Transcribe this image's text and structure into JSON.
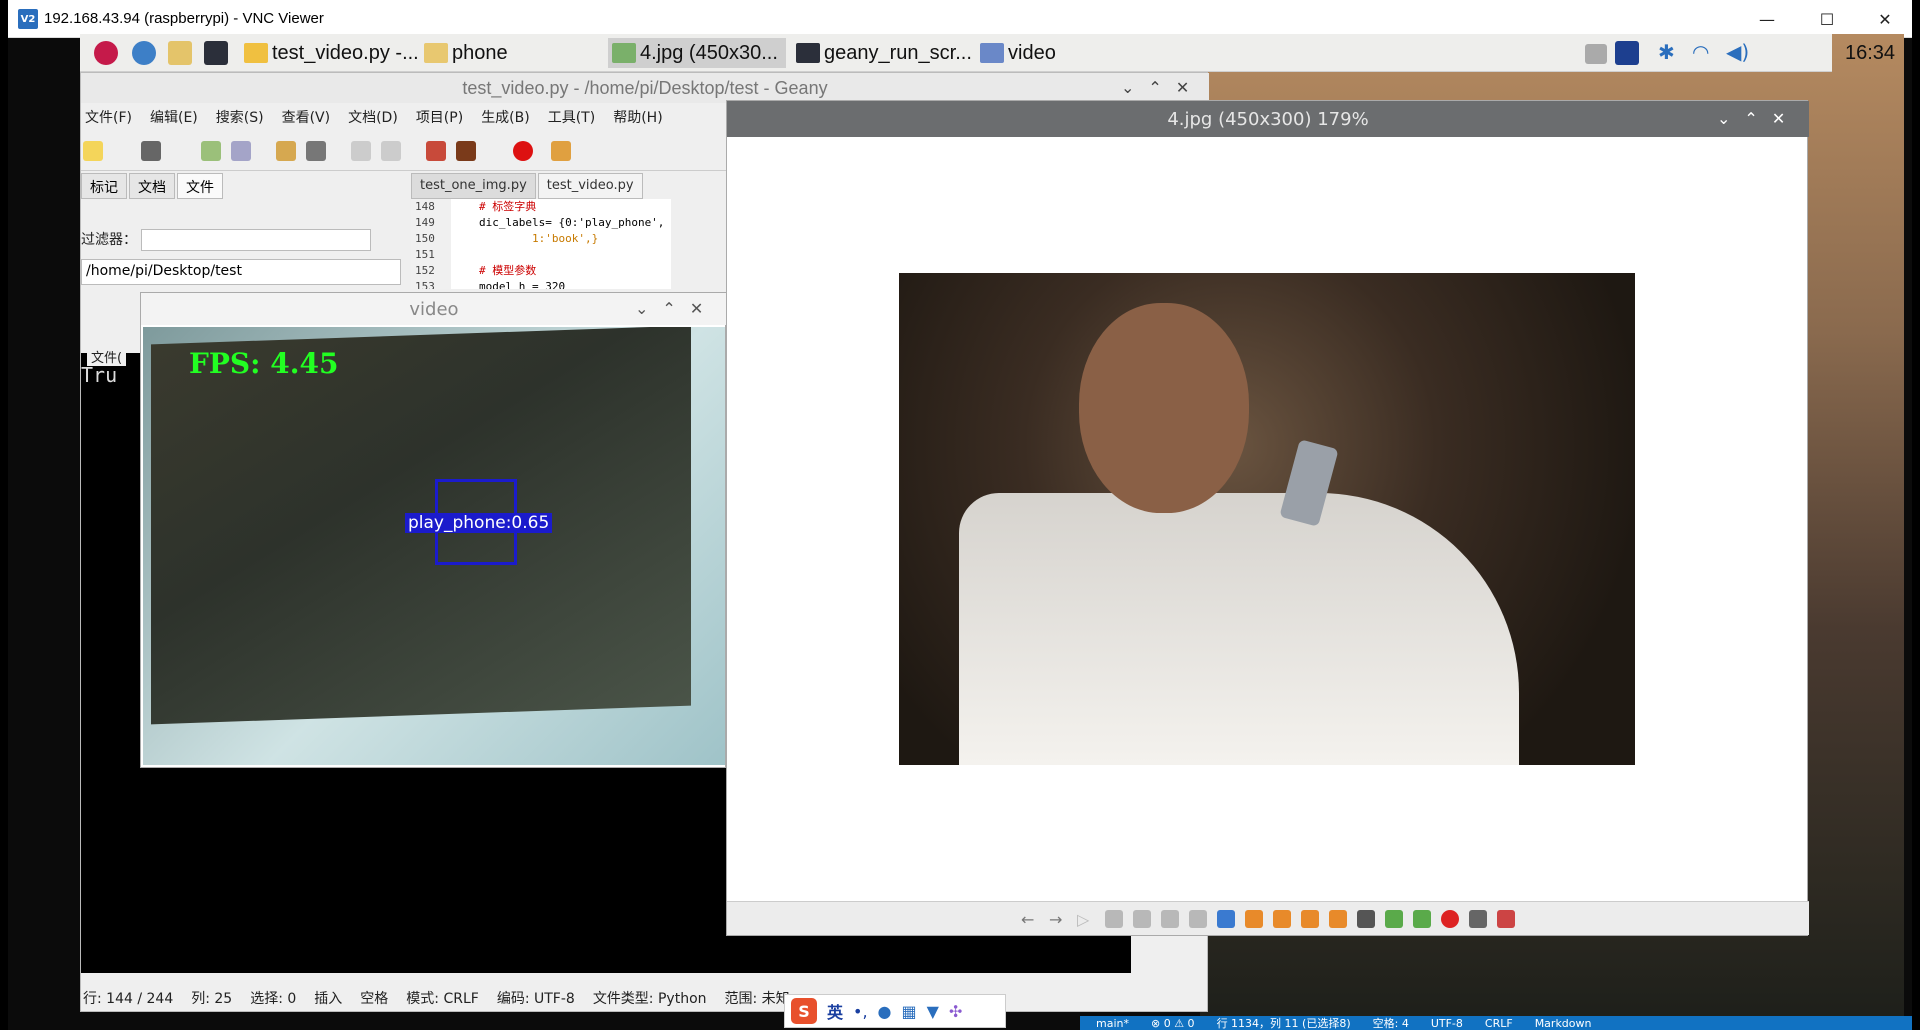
{
  "vnc": {
    "title": "192.168.43.94 (raspberrypi) - VNC Viewer",
    "logo": "V2"
  },
  "taskbar": {
    "apps": [
      "test_video.py -...",
      "phone",
      "4.jpg (450x30...",
      "geany_run_scr...",
      "video"
    ],
    "clock": "16:34"
  },
  "geany": {
    "title": "test_video.py - /home/pi/Desktop/test - Geany",
    "menu": [
      "文件(F)",
      "编辑(E)",
      "搜索(S)",
      "查看(V)",
      "文档(D)",
      "项目(P)",
      "生成(B)",
      "工具(T)",
      "帮助(H)"
    ],
    "side_tabs": [
      "标记",
      "文档",
      "文件"
    ],
    "filter_label": "过滤器：",
    "path": "/home/pi/Desktop/test",
    "editor_tabs": [
      "test_one_img.py",
      "test_video.py"
    ],
    "code": [
      {
        "n": "148",
        "c": "# 标签字典",
        "k": "cm"
      },
      {
        "n": "149",
        "c": "dic_labels= {0:'play_phone',",
        "k": ""
      },
      {
        "n": "150",
        "c": "        1:'book',}",
        "k": ""
      },
      {
        "n": "151",
        "c": "",
        "k": ""
      },
      {
        "n": "152",
        "c": "# 模型参数",
        "k": "cm"
      },
      {
        "n": "153",
        "c": "model_h = 320",
        "k": ""
      }
    ],
    "terminal_text": "Tru",
    "side_label": "文件(",
    "status": [
      "行: 144 / 244",
      "列: 25",
      "选择: 0",
      "插入",
      "空格",
      "模式: CRLF",
      "编码: UTF-8",
      "文件类型: Python",
      "范围: 未知"
    ]
  },
  "video": {
    "title": "video",
    "fps": "FPS: 4.45",
    "detection_label": "play_phone:0.65"
  },
  "viewer": {
    "title": "4.jpg (450x300) 179%"
  },
  "ime": {
    "logo": "S",
    "mode": "英",
    "punct": "•,"
  },
  "vscode_status": [
    "main*",
    "⊗ 0 ⚠ 0",
    "行 1134，列 11 (已选择8)",
    "空格: 4",
    "UTF-8",
    "CRLF",
    "Markdown"
  ]
}
